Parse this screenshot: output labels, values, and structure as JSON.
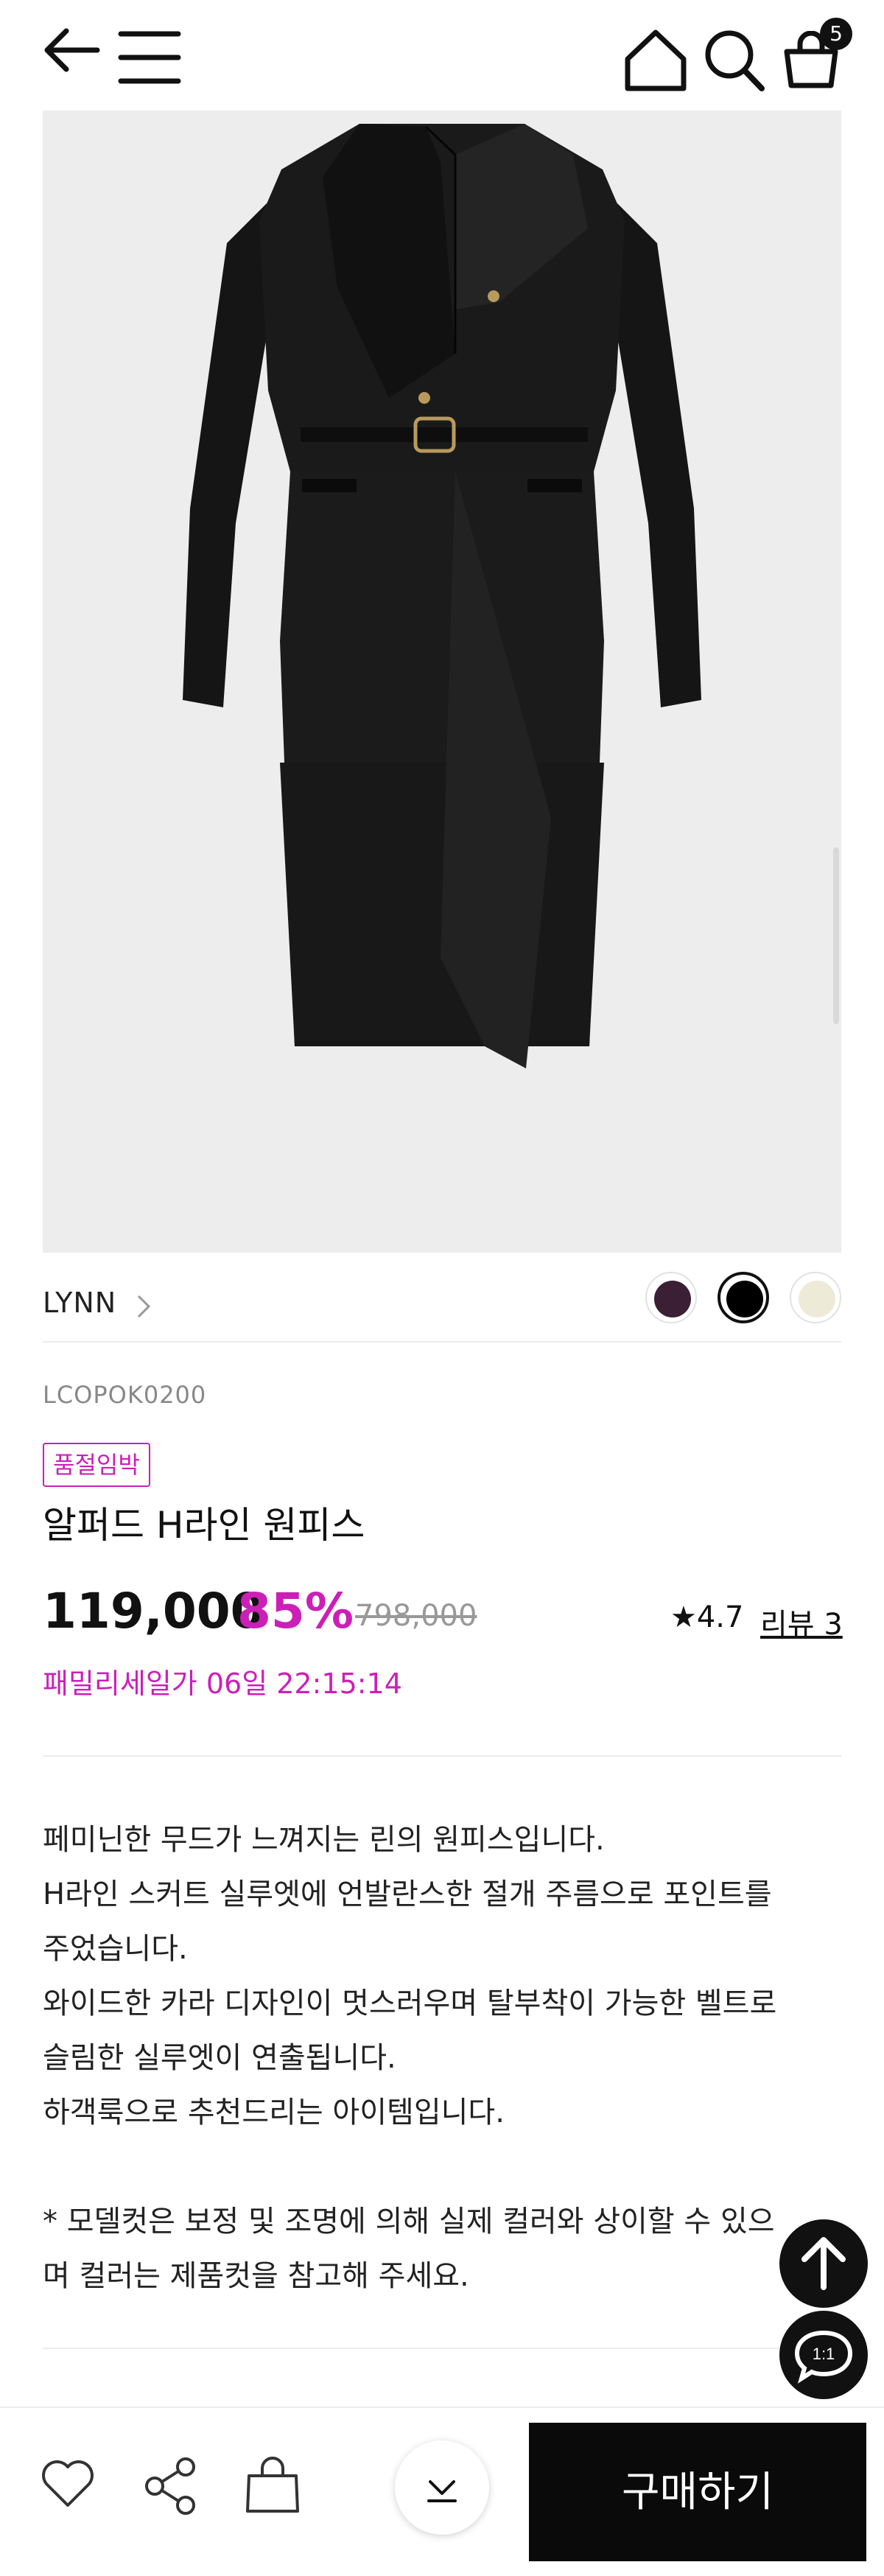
{
  "header": {
    "icons": [
      "back-arrow-icon",
      "menu-icon",
      "home-icon",
      "search-icon",
      "cart-icon"
    ],
    "cart_count": "5"
  },
  "product": {
    "brand": "LYNN",
    "code": "LCOPOK0200",
    "stock_badge": "품절임박",
    "name": "알퍼드 H라인 원피스",
    "price": "119,000",
    "discount": "85%",
    "original_price": "798,000",
    "rating": "★4.7",
    "review_label": "리뷰 3",
    "sale_timer": "패밀리세일가 06일 22:15:14",
    "colors": [
      "#3b1f35",
      "#000000",
      "#eeead8"
    ],
    "selected_color_index": 1,
    "description": [
      "페미닌한 무드가 느껴지는 린의 원피스입니다.",
      "H라인 스커트 실루엣에 언발란스한 절개 주름으로 포인트를",
      "주었습니다.",
      "와이드한 카라 디자인이 멋스러우며 탈부착이 가능한 벨트로",
      "슬림한 실루엣이 연출됩니다.",
      "하객룩으로 추천드리는 아이템입니다.",
      "",
      "* 모델컷은 보정 및 조명에 의해 실제 컬러와 상이할 수 있으",
      "며 컬러는 제품컷을 참고해 주세요."
    ]
  },
  "floating": {
    "chat_label": "1:1"
  },
  "bottom_bar": {
    "buy_label": "구매하기"
  }
}
